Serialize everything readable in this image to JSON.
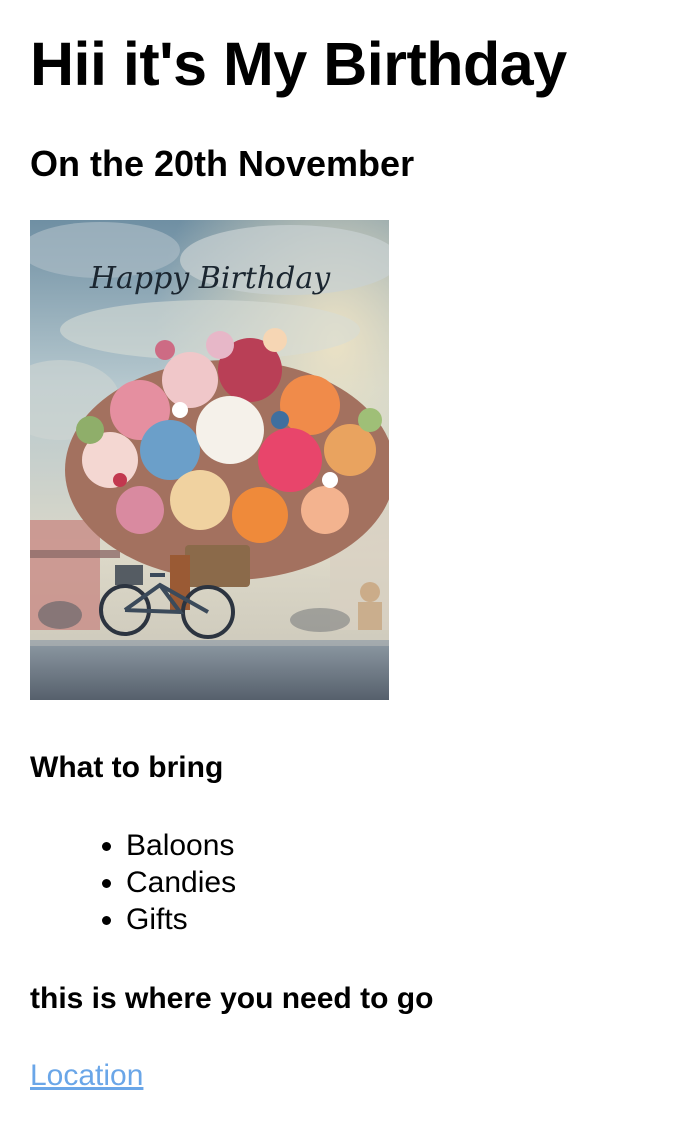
{
  "header": {
    "title": "Hii it's My Birthday",
    "date_heading": "On the 20th November"
  },
  "photo": {
    "caption_text": "Happy Birthday",
    "icon": "birthday-flower-bicycle-photo"
  },
  "bring_section": {
    "heading": "What to bring",
    "items": [
      {
        "label": "Baloons"
      },
      {
        "label": "Candies"
      },
      {
        "label": "Gifts"
      }
    ]
  },
  "location_section": {
    "heading": "this is where you need to go",
    "link_label": "Location"
  },
  "colors": {
    "link": "#6aa6e8",
    "text": "#000000",
    "background": "#ffffff"
  }
}
